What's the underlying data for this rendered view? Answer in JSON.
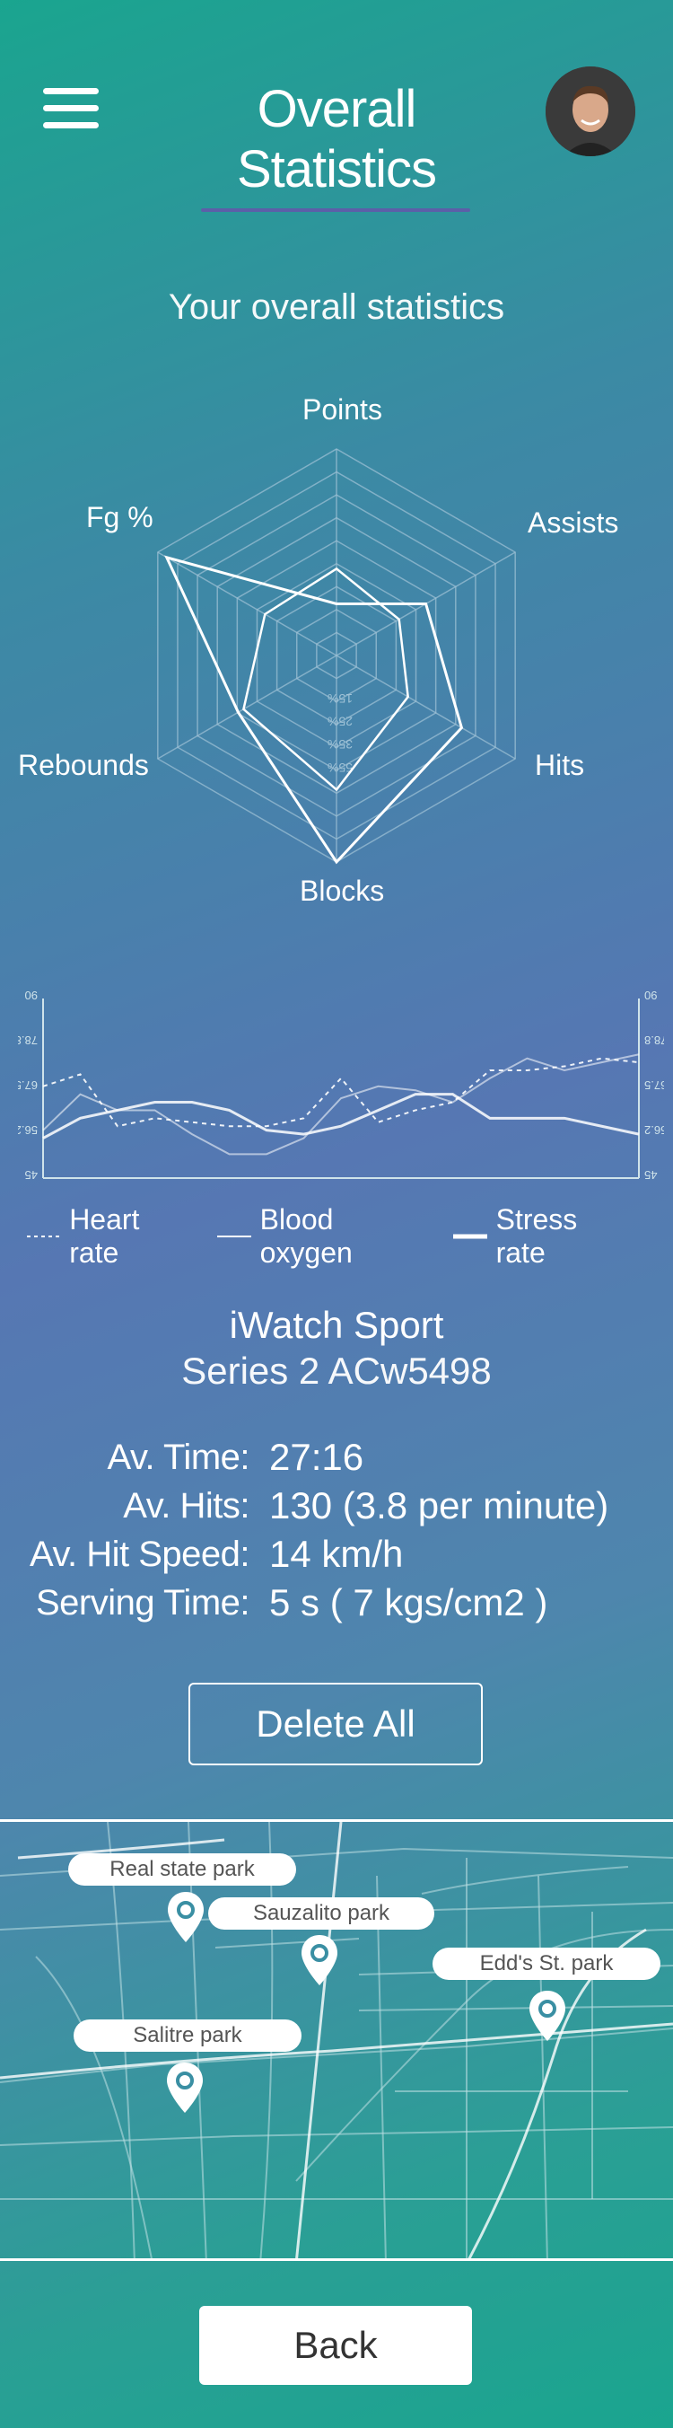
{
  "header": {
    "title": "Overall Statistics",
    "menu_icon": "hamburger-menu-icon",
    "avatar": "user-avatar"
  },
  "subtitle": "Your overall statistics",
  "radar": {
    "axes": [
      "Points",
      "Assists",
      "Hits",
      "Blocks",
      "Rebounds",
      "Fg %"
    ],
    "rings": 9,
    "ring_labels": [
      "15%",
      "25%",
      "35%",
      "55%"
    ],
    "outer_series": [
      0.25,
      0.5,
      0.7,
      1.0,
      0.55,
      0.95
    ],
    "inner_series": [
      0.42,
      0.35,
      0.4,
      0.65,
      0.52,
      0.4
    ],
    "colors": {
      "grid": "#9fc2d6",
      "line": "#ffffff"
    }
  },
  "line_chart": {
    "y_ticks": [
      "90",
      "78.8",
      "67.5",
      "56.2",
      "45"
    ],
    "series": [
      {
        "name": "Heart rate",
        "style": "dashed",
        "values": [
          68,
          71,
          58,
          60,
          59,
          58,
          58,
          60,
          70,
          59,
          62,
          64,
          72,
          72,
          73,
          75,
          74
        ]
      },
      {
        "name": "Blood oxygen",
        "style": "solid-thin",
        "values": [
          57,
          66,
          62,
          62,
          56,
          51,
          51,
          55,
          65,
          68,
          67,
          64,
          70,
          75,
          72,
          74,
          76
        ]
      },
      {
        "name": "Stress rate",
        "style": "solid-thick",
        "values": [
          55,
          60,
          62,
          64,
          64,
          62,
          57,
          56,
          58,
          62,
          66,
          66,
          60,
          60,
          60,
          58,
          56
        ]
      }
    ]
  },
  "legend": {
    "items": [
      "Heart rate",
      "Blood oxygen",
      "Stress rate"
    ]
  },
  "device": {
    "name": "iWatch Sport",
    "series": "Series 2 ACw5498"
  },
  "stats": [
    {
      "label": "Av. Time:",
      "value": "27:16"
    },
    {
      "label": "Av. Hits:",
      "value": "130 (3.8 per minute)"
    },
    {
      "label": "Av. Hit Speed:",
      "value": "14 km/h"
    },
    {
      "label": "Serving Time:",
      "value": "5 s ( 7 kgs/cm2 )"
    }
  ],
  "buttons": {
    "delete_all": "Delete All",
    "back": "Back"
  },
  "map": {
    "parks": [
      {
        "name": "Real state park"
      },
      {
        "name": "Sauzalito park"
      },
      {
        "name": "Edd's St. park"
      },
      {
        "name": "Salitre park"
      }
    ],
    "pin_icon": "map-pin-icon"
  }
}
